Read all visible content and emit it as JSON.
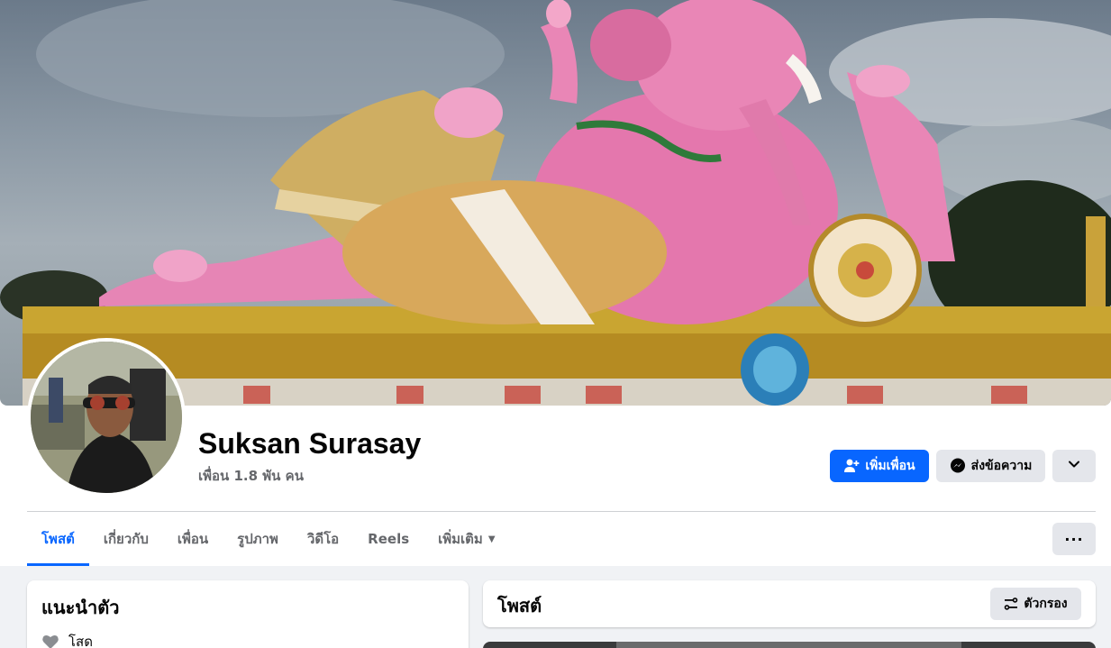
{
  "profile": {
    "name": "Suksan Surasay",
    "friends_count": "เพื่อน 1.8 พัน คน"
  },
  "actions": {
    "add_friend": "เพิ่มเพื่อน",
    "message": "ส่งข้อความ",
    "more_icon": "chevron-down-icon"
  },
  "tabs": [
    {
      "label": "โพสต์",
      "active": true
    },
    {
      "label": "เกี่ยวกับ",
      "active": false
    },
    {
      "label": "เพื่อน",
      "active": false
    },
    {
      "label": "รูปภาพ",
      "active": false
    },
    {
      "label": "วิดีโอ",
      "active": false
    },
    {
      "label": "Reels",
      "active": false
    },
    {
      "label": "เพิ่มเติม",
      "active": false
    }
  ],
  "tabs_more_dots": "···",
  "intro": {
    "title": "แนะนำตัว",
    "relationship": "โสด"
  },
  "posts": {
    "title": "โพสต์",
    "filter": "ตัวกรอง"
  },
  "colors": {
    "accent": "#0866ff",
    "secondary_button": "#e4e6eb",
    "page_bg": "#f0f2f5"
  }
}
